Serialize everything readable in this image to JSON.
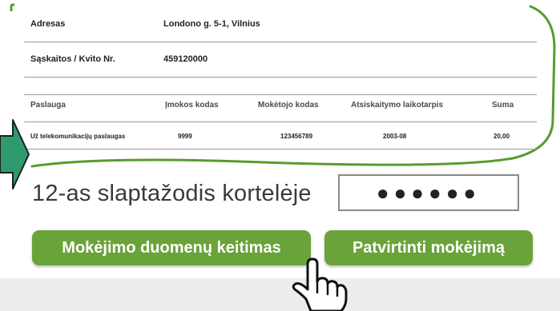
{
  "info_rows": [
    {
      "label": "Adresas",
      "value": "Londono g. 5-1, Vilnius"
    },
    {
      "label": "Sąskaitos / Kvito Nr.",
      "value": "459120000"
    }
  ],
  "payments_table": {
    "columns": [
      "Paslauga",
      "Įmokos kodas",
      "Mokėtojo kodas",
      "Atsiskaitymo laikotarpis",
      "Suma"
    ],
    "rows": [
      [
        "Už telekomunikacijų paslaugas",
        "9999",
        "123456789",
        "2003-08",
        "20,00"
      ]
    ]
  },
  "pin": {
    "label": "12-as slaptažodis kortelėje",
    "masked_value": "●●●●●●"
  },
  "buttons": {
    "change_payment_data": "Mokėjimo duomenų keitimas",
    "confirm_payment": "Patvirtinti mokėjimą"
  },
  "colors": {
    "accent_green": "#6aa33a",
    "highlight_stroke": "#5a9a2e",
    "arrow_fill": "#2e9b6e"
  },
  "icons": {
    "pointer": "hand-pointer-icon",
    "arrow": "arrow-right-icon"
  }
}
